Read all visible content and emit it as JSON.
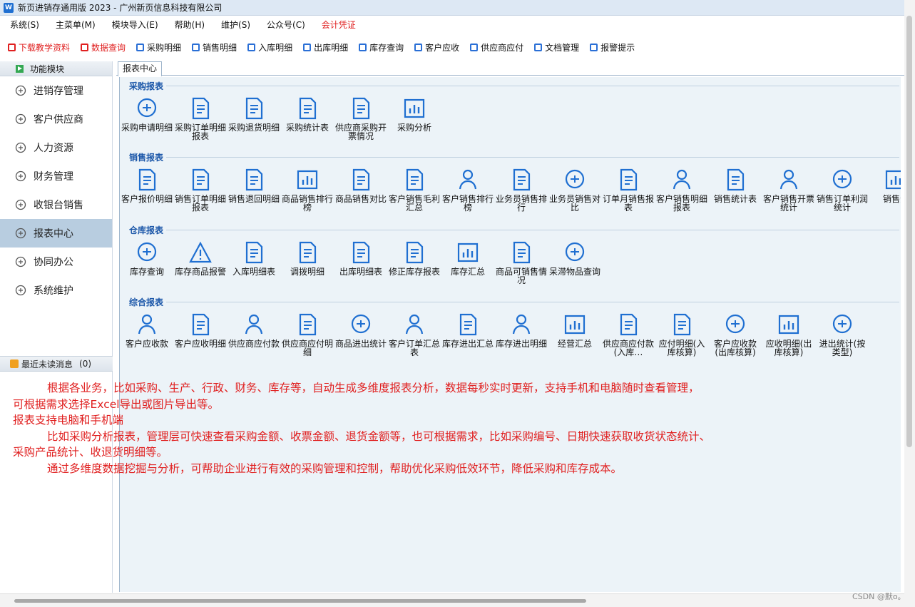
{
  "window": {
    "title": "新页进销存通用版 2023 - 广州新页信息科技有限公司"
  },
  "menu": [
    {
      "label": "系统(S)",
      "red": false
    },
    {
      "label": "主菜单(M)",
      "red": false
    },
    {
      "label": "模块导入(E)",
      "red": false
    },
    {
      "label": "帮助(H)",
      "red": false
    },
    {
      "label": "维护(S)",
      "red": false
    },
    {
      "label": "公众号(C)",
      "red": false
    },
    {
      "label": "会计凭证",
      "red": true
    }
  ],
  "toolbar": [
    {
      "label": "下载教学资料",
      "red": true
    },
    {
      "label": "数据查询",
      "red": true
    },
    {
      "label": "采购明细",
      "red": false
    },
    {
      "label": "销售明细",
      "red": false
    },
    {
      "label": "入库明细",
      "red": false
    },
    {
      "label": "出库明细",
      "red": false
    },
    {
      "label": "库存查询",
      "red": false
    },
    {
      "label": "客户应收",
      "red": false
    },
    {
      "label": "供应商应付",
      "red": false
    },
    {
      "label": "文档管理",
      "red": false
    },
    {
      "label": "报警提示",
      "red": false
    }
  ],
  "sidebar": {
    "header": "功能模块",
    "items": [
      {
        "label": "进销存管理",
        "icon": "award-icon"
      },
      {
        "label": "客户供应商",
        "icon": "list-icon"
      },
      {
        "label": "人力资源",
        "icon": "user-icon"
      },
      {
        "label": "财务管理",
        "icon": "money-icon"
      },
      {
        "label": "收银台销售",
        "icon": "chart-line-icon"
      },
      {
        "label": "报表中心",
        "icon": "monitor-icon",
        "active": true
      },
      {
        "label": "协同办公",
        "icon": "gear-icon"
      },
      {
        "label": "系统维护",
        "icon": "tools-icon"
      }
    ]
  },
  "messages": {
    "header": "最近未读消息",
    "count": "(0)"
  },
  "tab": {
    "label": "报表中心"
  },
  "sections": [
    {
      "title": "采购报表",
      "items": [
        {
          "label": "采购申请明细",
          "icon": "cart-circle-icon"
        },
        {
          "label": "采购订单明细报表",
          "icon": "cart-doc-icon"
        },
        {
          "label": "采购退货明细",
          "icon": "return-doc-icon"
        },
        {
          "label": "采购统计表",
          "icon": "cart-icon"
        },
        {
          "label": "供应商采购开票情况",
          "icon": "ticket-icon"
        },
        {
          "label": "采购分析",
          "icon": "chart-box-icon"
        }
      ]
    },
    {
      "title": "销售报表",
      "items": [
        {
          "label": "客户报价明细",
          "icon": "yen-doc-icon"
        },
        {
          "label": "销售订单明细报表",
          "icon": "edit-doc-icon"
        },
        {
          "label": "销售退回明细",
          "icon": "inbox-icon"
        },
        {
          "label": "商品销售排行榜",
          "icon": "bar-ranking-icon"
        },
        {
          "label": "商品销售对比",
          "icon": "squares-icon"
        },
        {
          "label": "客户销售毛利汇总",
          "icon": "doc-clock-icon"
        },
        {
          "label": "客户销售排行榜",
          "icon": "user-chart-icon"
        },
        {
          "label": "业务员销售排行",
          "icon": "star-badge-icon"
        },
        {
          "label": "业务员销售对比",
          "icon": "pie-icon"
        },
        {
          "label": "订单月销售报表",
          "icon": "line-board-icon"
        },
        {
          "label": "客户销售明细报表",
          "icon": "user-doc-icon"
        },
        {
          "label": "销售统计表",
          "icon": "clock-doc-icon"
        },
        {
          "label": "客户销售开票统计",
          "icon": "user-yen-icon"
        },
        {
          "label": "销售订单利润统计",
          "icon": "location-icon"
        },
        {
          "label": "销售分",
          "icon": "bar-doc-icon"
        }
      ]
    },
    {
      "title": "仓库报表",
      "items": [
        {
          "label": "库存查询",
          "icon": "magnifier-icon"
        },
        {
          "label": "库存商品报警",
          "icon": "warning-icon"
        },
        {
          "label": "入库明细表",
          "icon": "list-doc-icon"
        },
        {
          "label": "调拨明细",
          "icon": "transfer-icon"
        },
        {
          "label": "出库明细表",
          "icon": "out-doc-icon"
        },
        {
          "label": "修正库存报表",
          "icon": "edit-box-icon"
        },
        {
          "label": "库存汇总",
          "icon": "bar-box-icon"
        },
        {
          "label": "商品可销售情况",
          "icon": "bag-check-icon"
        },
        {
          "label": "呆滞物品查询",
          "icon": "cube-icon"
        }
      ]
    },
    {
      "title": "综合报表",
      "items": [
        {
          "label": "客户应收款",
          "icon": "user-yen-icon"
        },
        {
          "label": "客户应收明细",
          "icon": "id-card-icon"
        },
        {
          "label": "供应商应付款",
          "icon": "user-dollar-icon"
        },
        {
          "label": "供应商应付明细",
          "icon": "dollar-card-icon"
        },
        {
          "label": "商品进出统计",
          "icon": "inout-circle-icon"
        },
        {
          "label": "客户订单汇总表",
          "icon": "check-user-icon"
        },
        {
          "label": "库存进出汇总",
          "icon": "check-doc-icon"
        },
        {
          "label": "库存进出明细",
          "icon": "doc-user-icon"
        },
        {
          "label": "经营汇总",
          "icon": "building-icon"
        },
        {
          "label": "供应商应付款(入库…",
          "icon": "crown-icon"
        },
        {
          "label": "应付明细(入库核算)",
          "icon": "crown-doc-icon"
        },
        {
          "label": "客户应收款(出库核算)",
          "icon": "crown-circle-icon"
        },
        {
          "label": "应收明细(出库核算)",
          "icon": "step-bars-icon"
        },
        {
          "label": "进出统计(按类型)",
          "icon": "stop-circle-icon"
        }
      ]
    }
  ],
  "description": [
    {
      "text": "根据各业务，比如采购、生产、行政、财务、库存等，自动生成多维度报表分析，数据每秒实时更新，支持手机和电脑随时查看管理，",
      "indent": true
    },
    {
      "text": "可根据需求选择Excel导出或图片导出等。",
      "indent": false
    },
    {
      "text": "报表支持电脑和手机端",
      "indent": false
    },
    {
      "text": "比如采购分析报表，管理层可快速查看采购金额、收票金额、退货金额等，也可根据需求，比如采购编号、日期快速获取收货状态统计、",
      "indent": true
    },
    {
      "text": "采购产品统计、收退货明细等。",
      "indent": false
    },
    {
      "text": "通过多维度数据挖掘与分析，可帮助企业进行有效的采购管理和控制，帮助优化采购低效环节，降低采购和库存成本。",
      "indent": true
    }
  ],
  "watermark": "CSDN @默o。",
  "colors": {
    "accent": "#1f6fd1",
    "alert": "#e02020",
    "panel": "#ecf3f8",
    "active": "#b8cde0"
  }
}
